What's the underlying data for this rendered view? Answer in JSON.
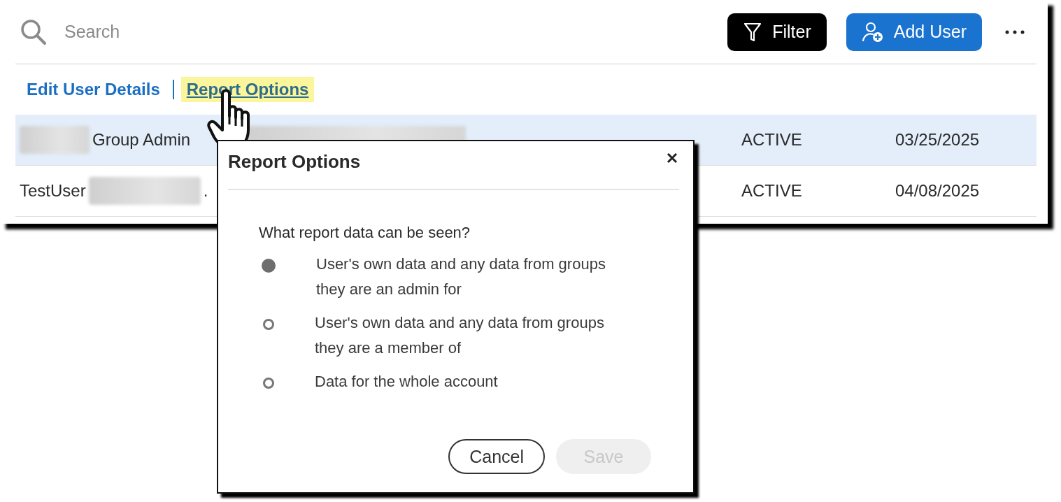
{
  "search": {
    "placeholder": "Search"
  },
  "toolbar": {
    "buttons": [
      {
        "kind": "filter",
        "label": "Filter"
      },
      {
        "kind": "add-user",
        "label": "Add User"
      }
    ]
  },
  "links": [
    {
      "label": "Edit User Details",
      "selected": false
    },
    {
      "label": "Report Options",
      "selected": true
    }
  ],
  "rows": [
    {
      "selected": true,
      "name": [
        {
          "kind": "redacted"
        },
        {
          "kind": "text",
          "text": "Group Admin"
        }
      ],
      "email": [
        {
          "kind": "redacted"
        }
      ],
      "status": "ACTIVE",
      "date": "03/25/2025"
    },
    {
      "selected": false,
      "name": [
        {
          "kind": "text",
          "text": "TestUser"
        },
        {
          "kind": "redacted"
        },
        {
          "kind": "text",
          "text": "."
        }
      ],
      "status": "ACTIVE",
      "date": "04/08/2025"
    }
  ],
  "dialog": {
    "title": "Report Options",
    "question": "What report data can be seen?",
    "options": [
      {
        "label": "User's own data and any data from groups they are an admin for",
        "selected": true
      },
      {
        "label": "User's own data and any data from groups they are a member of",
        "selected": false
      },
      {
        "label": "Data for the whole account",
        "selected": false
      }
    ],
    "buttons": [
      {
        "kind": "secondary",
        "label": "Cancel",
        "disabled": false
      },
      {
        "kind": "primary",
        "label": "Save",
        "disabled": true
      }
    ]
  }
}
